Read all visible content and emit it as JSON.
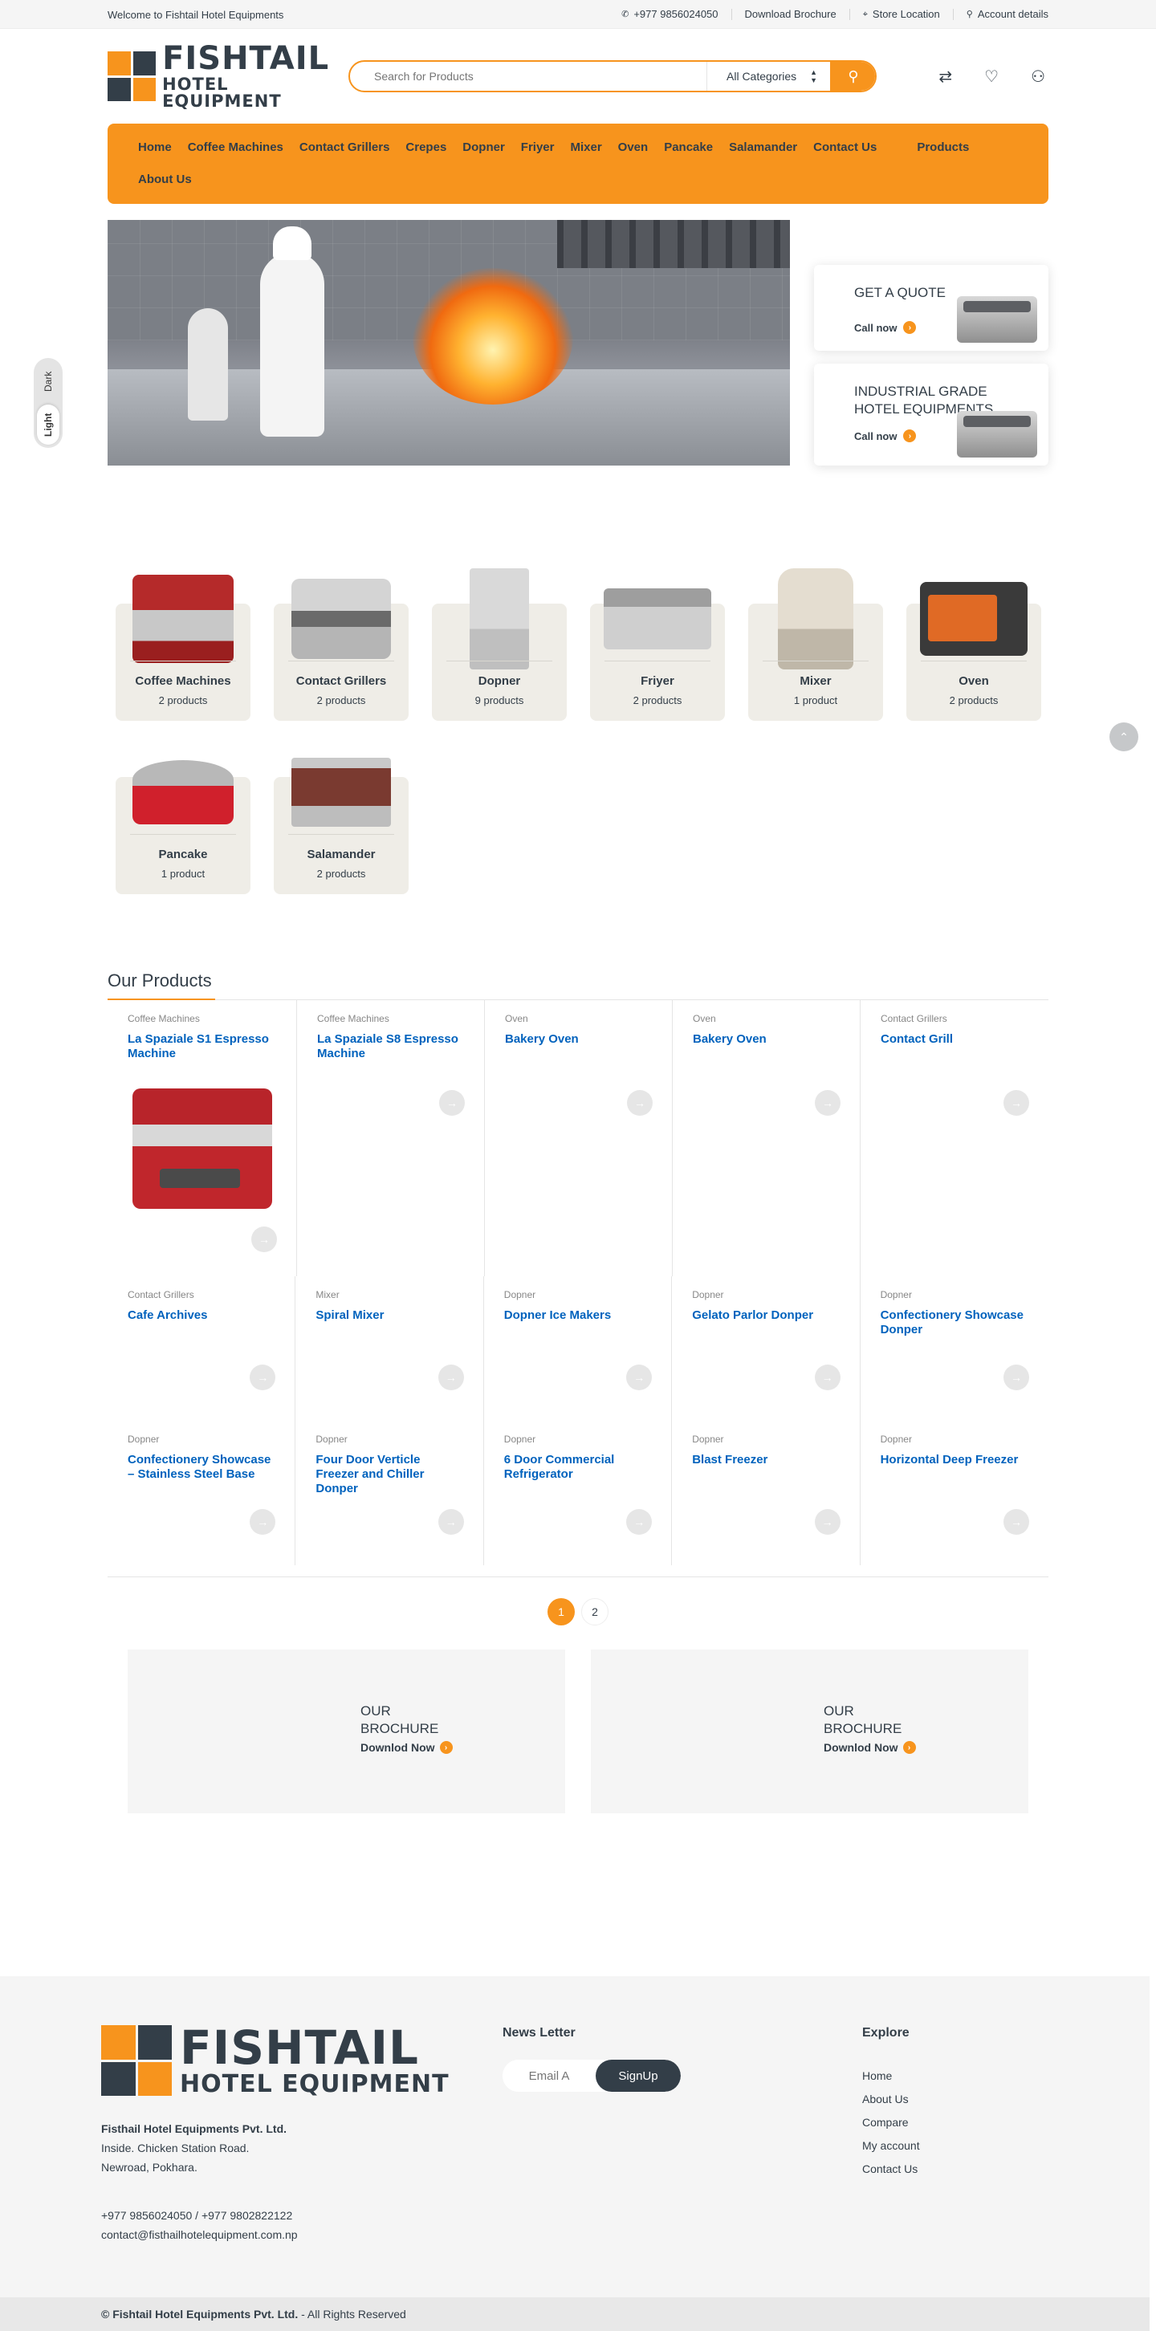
{
  "topbar": {
    "welcome": "Welcome to Fishtail Hotel Equipments",
    "phone": "+977 9856024050",
    "brochure": "Download Brochure",
    "store": "Store Location",
    "account": "Account details"
  },
  "brand": {
    "name_big": "FISHTAIL",
    "name_small": "HOTEL EQUIPMENT",
    "primary_color": "#f7941d",
    "dark_color": "#333e48",
    "link_color": "#0062bd"
  },
  "search": {
    "placeholder": "Search for Products",
    "category": "All Categories"
  },
  "nav": {
    "items": [
      "Home",
      "Coffee Machines",
      "Contact Grillers",
      "Crepes",
      "Dopner",
      "Friyer",
      "Mixer",
      "Oven",
      "Pancake",
      "Salamander",
      "Contact Us",
      "Products",
      "About Us"
    ]
  },
  "hero": {
    "card1_title": "GET A QUOTE",
    "card1_cta": "Call now",
    "card2_title": "INDUSTRIAL GRADE HOTEL EQUIPMENTS",
    "card2_cta": "Call now"
  },
  "theme": {
    "dark": "Dark",
    "light": "Light"
  },
  "categories": [
    {
      "name": "Coffee Machines",
      "count": "2 products"
    },
    {
      "name": "Contact Grillers",
      "count": "2 products"
    },
    {
      "name": "Dopner",
      "count": "9 products"
    },
    {
      "name": "Friyer",
      "count": "2 products"
    },
    {
      "name": "Mixer",
      "count": "1 product"
    },
    {
      "name": "Oven",
      "count": "2 products"
    },
    {
      "name": "Pancake",
      "count": "1 product"
    },
    {
      "name": "Salamander",
      "count": "2 products"
    }
  ],
  "products_section": {
    "title": "Our Products",
    "items": [
      {
        "cat": "Coffee Machines",
        "name": "La Spaziale S1 Espresso Machine"
      },
      {
        "cat": "Coffee Machines",
        "name": "La Spaziale S8 Espresso Machine"
      },
      {
        "cat": "Oven",
        "name": "Bakery Oven"
      },
      {
        "cat": "Oven",
        "name": "Bakery Oven"
      },
      {
        "cat": "Contact Grillers",
        "name": "Contact Grill"
      },
      {
        "cat": "Contact Grillers",
        "name": "Cafe Archives"
      },
      {
        "cat": "Mixer",
        "name": "Spiral Mixer"
      },
      {
        "cat": "Dopner",
        "name": "Dopner Ice Makers"
      },
      {
        "cat": "Dopner",
        "name": "Gelato Parlor Donper"
      },
      {
        "cat": "Dopner",
        "name": "Confectionery Showcase Donper"
      },
      {
        "cat": "Dopner",
        "name": "Confectionery Showcase – Stainless Steel Base"
      },
      {
        "cat": "Dopner",
        "name": "Four Door Verticle Freezer and Chiller Donper"
      },
      {
        "cat": "Dopner",
        "name": "6 Door Commercial Refrigerator"
      },
      {
        "cat": "Dopner",
        "name": "Blast Freezer"
      },
      {
        "cat": "Dopner",
        "name": "Horizontal Deep Freezer"
      }
    ]
  },
  "pagination": {
    "current": "1",
    "next": "2"
  },
  "brochures": [
    {
      "title": "OUR BROCHURE",
      "cta": "Downlod Now"
    },
    {
      "title": "OUR BROCHURE",
      "cta": "Downlod Now"
    }
  ],
  "footer": {
    "company": "Fisthail Hotel Equipments Pvt. Ltd.",
    "address1": "Inside. Chicken Station Road.",
    "address2": "Newroad, Pokhara.",
    "phones": "+977 9856024050 / +977 9802822122",
    "email": "contact@fisthailhotelequipment.com.np",
    "newsletter_title": "News Letter",
    "email_placeholder": "Email A",
    "signup": "SignUp",
    "explore_title": "Explore",
    "explore_links": [
      "Home",
      "About Us",
      "Compare",
      "My account",
      "Contact Us"
    ],
    "copyright_company": "© Fishtail Hotel Equipments Pvt. Ltd.",
    "copyright_rest": " - All Rights Reserved"
  }
}
